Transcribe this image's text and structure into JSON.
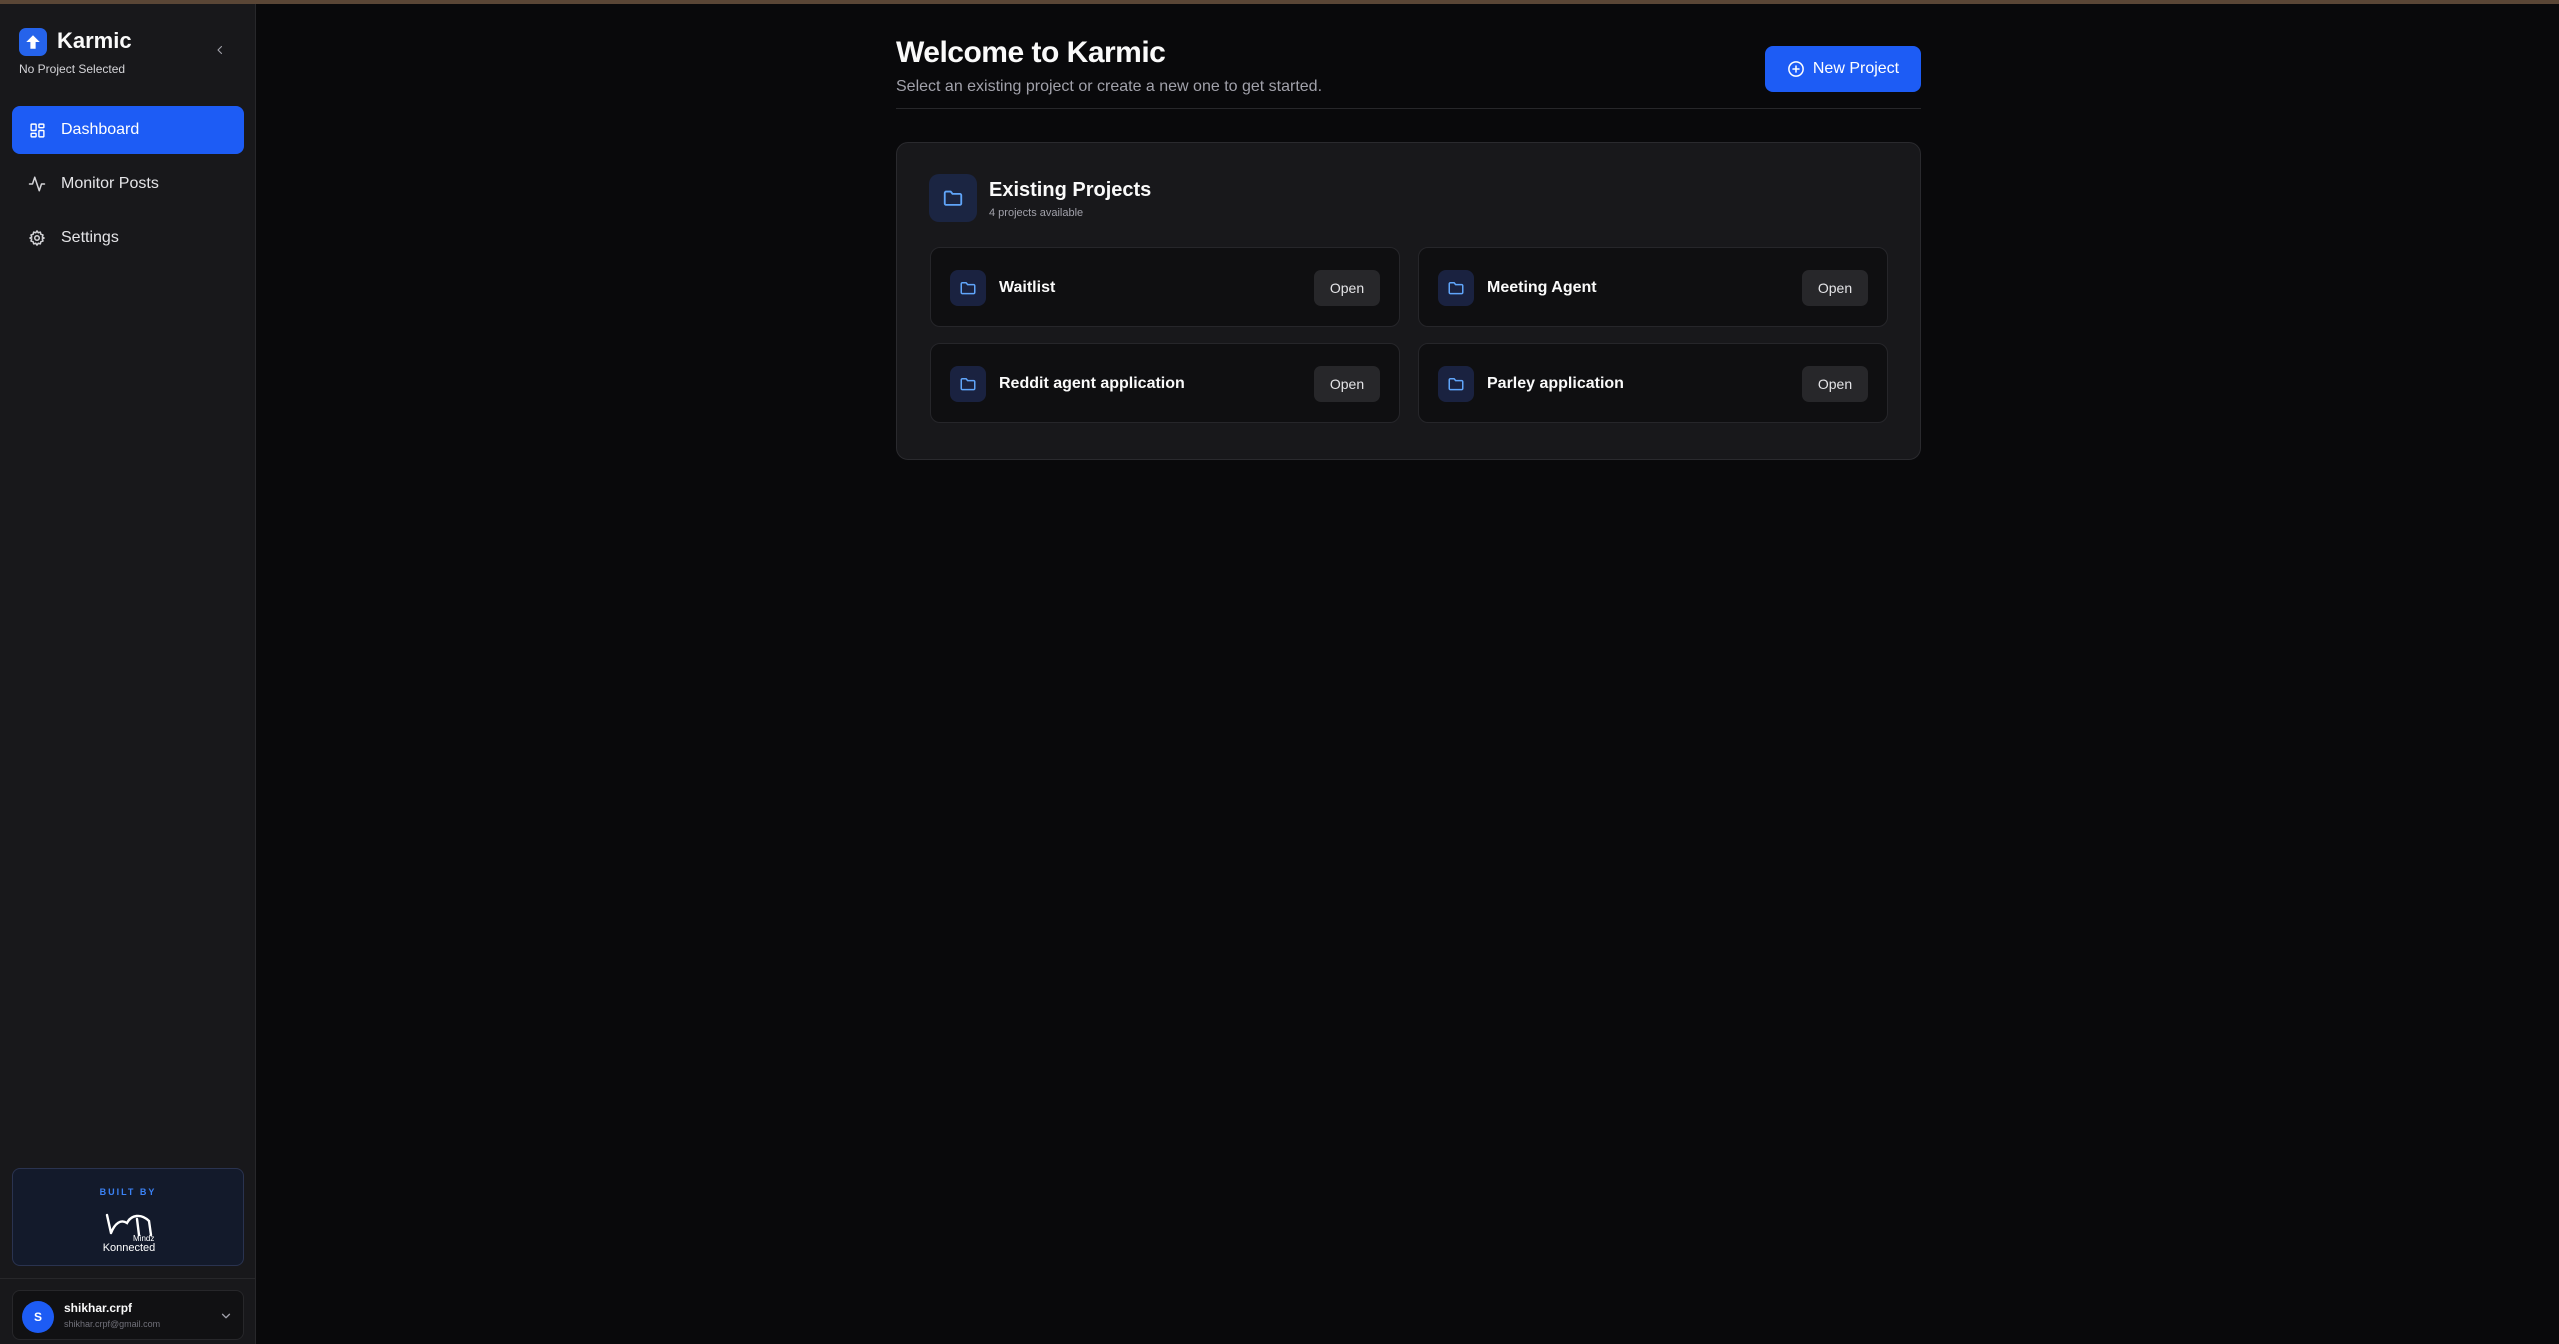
{
  "app": {
    "name": "Karmic",
    "project_status": "No Project Selected"
  },
  "sidebar": {
    "items": [
      {
        "label": "Dashboard",
        "icon": "dashboard-icon",
        "active": true
      },
      {
        "label": "Monitor Posts",
        "icon": "activity-icon",
        "active": false
      },
      {
        "label": "Settings",
        "icon": "gear-icon",
        "active": false
      }
    ],
    "built_by": {
      "label": "BUILT BY",
      "logo_text": "Mindz Konnected"
    },
    "user": {
      "initial": "S",
      "name": "shikhar.crpf",
      "email": "shikhar.crpf@gmail.com"
    }
  },
  "header": {
    "title": "Welcome to Karmic",
    "subtitle": "Select an existing project or create a new one to get started.",
    "new_project_label": "New Project"
  },
  "projects_panel": {
    "title": "Existing Projects",
    "count_text": "4 projects available",
    "open_label": "Open",
    "projects": [
      {
        "name": "Waitlist"
      },
      {
        "name": "Meeting Agent"
      },
      {
        "name": "Reddit agent application"
      },
      {
        "name": "Parley application"
      }
    ]
  },
  "colors": {
    "accent": "#1d5cf5",
    "background": "#09090b",
    "sidebar": "#18181b",
    "card": "#0f0f11"
  }
}
